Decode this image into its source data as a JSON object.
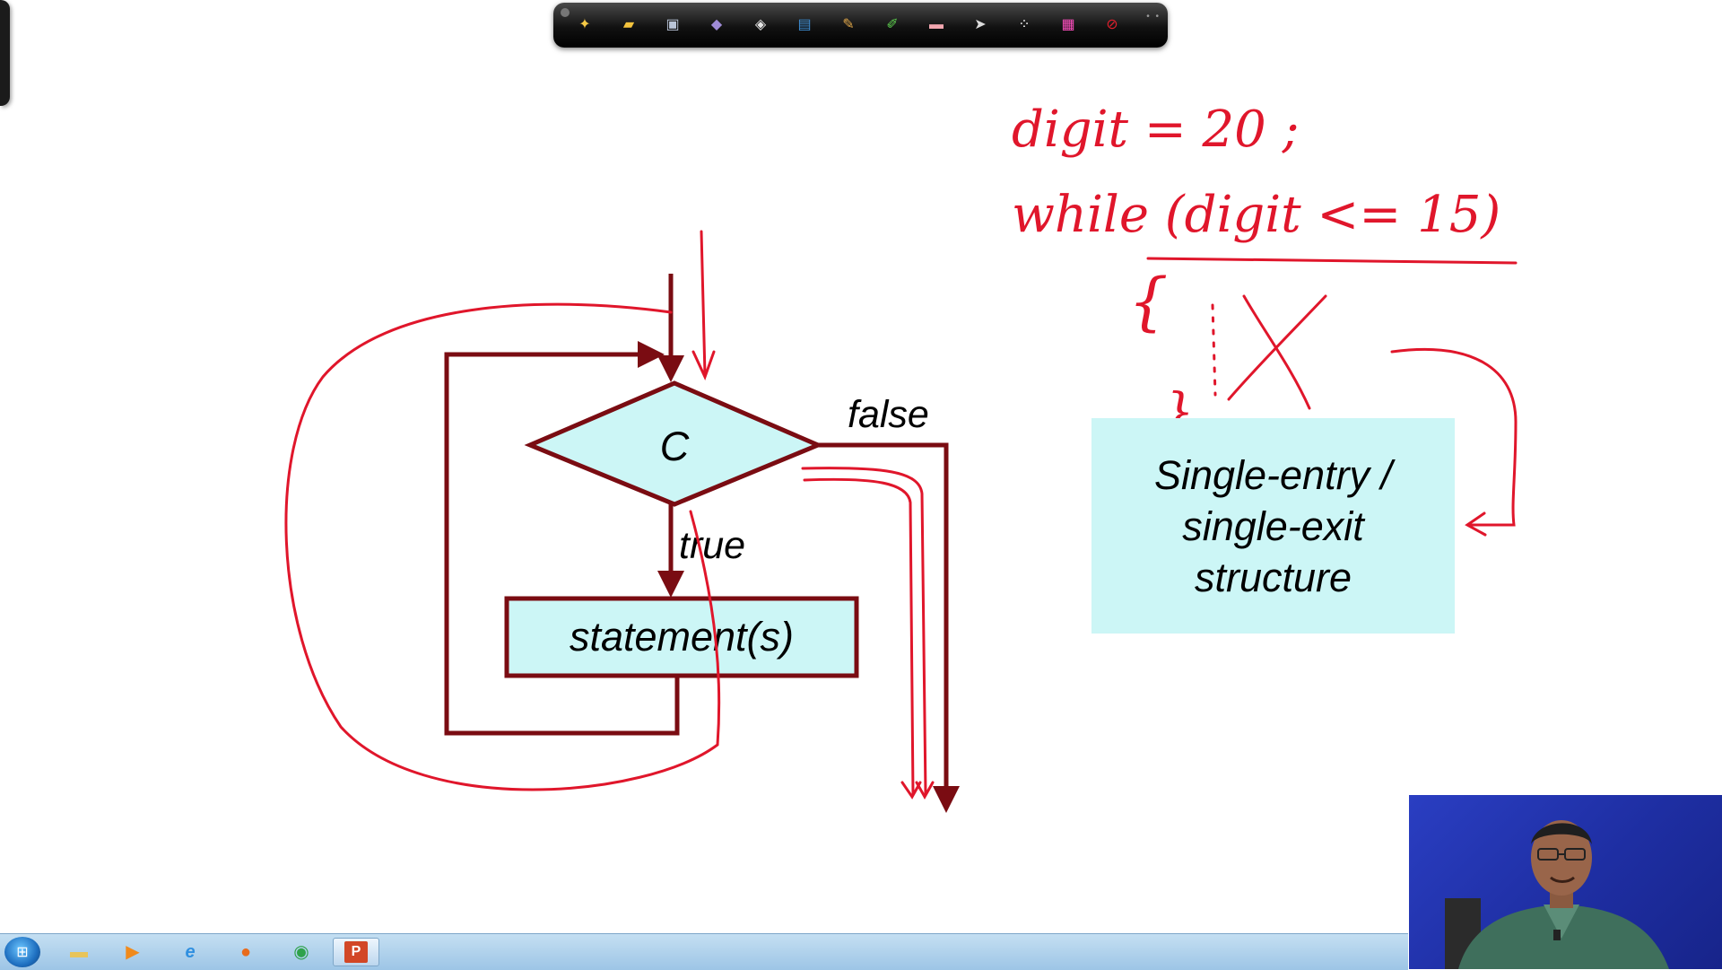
{
  "toolbar": {
    "tools": [
      {
        "icon": "pointer-star-icon",
        "glyph": "✦",
        "color": "#f6c945"
      },
      {
        "icon": "folder-icon",
        "glyph": "▰",
        "color": "#f4c33d"
      },
      {
        "icon": "save-disk-icon",
        "glyph": "▣",
        "color": "#b9c4d8"
      },
      {
        "icon": "page-icon",
        "glyph": "◆",
        "color": "#9f8bd6"
      },
      {
        "icon": "eraser-page-icon",
        "glyph": "◈",
        "color": "#e6e6e6"
      },
      {
        "icon": "screen-capture-icon",
        "glyph": "▤",
        "color": "#3e8fd6"
      },
      {
        "icon": "pencil-icon",
        "glyph": "✎",
        "color": "#e3a94a"
      },
      {
        "icon": "highlighter-icon",
        "glyph": "✐",
        "color": "#5ed04f"
      },
      {
        "icon": "eraser-icon",
        "glyph": "▬",
        "color": "#f2a7b0"
      },
      {
        "icon": "cursor-arrow-icon",
        "glyph": "➤",
        "color": "#dddddd"
      },
      {
        "icon": "dots-icon",
        "glyph": "⁘",
        "color": "#ffffff"
      },
      {
        "icon": "color-palette-icon",
        "glyph": "▦",
        "color": "#ff4fc0"
      },
      {
        "icon": "stop-icon",
        "glyph": "⊘",
        "color": "#e21f2c"
      }
    ]
  },
  "flowchart": {
    "condition_label": "C",
    "statement_label": "statement(s)",
    "true_label": "true",
    "false_label": "false"
  },
  "annotation": {
    "line1": "digit = 20 ;",
    "line2": "while (digit <= 15)",
    "open_brace": "{",
    "close_brace": "}"
  },
  "structure_box": {
    "line1": "Single-entry /",
    "line2": "single-exit",
    "line3": "structure"
  },
  "taskbar": {
    "items": [
      {
        "icon": "explorer-folder-icon",
        "glyph": "▬",
        "color": "#e8c45a"
      },
      {
        "icon": "media-player-icon",
        "glyph": "▶",
        "color": "#f08a1c"
      },
      {
        "icon": "internet-explorer-icon",
        "glyph": "e",
        "color": "#2f8fe0"
      },
      {
        "icon": "firefox-icon",
        "glyph": "●",
        "color": "#e86b1c"
      },
      {
        "icon": "chrome-icon",
        "glyph": "◉",
        "color": "#2ea24a"
      },
      {
        "icon": "powerpoint-icon",
        "glyph": "P",
        "color": "#d24726"
      }
    ]
  },
  "colors": {
    "flow_line": "#7a0c12",
    "shape_fill": "#ccf6f6",
    "ink": "#e0162b"
  }
}
